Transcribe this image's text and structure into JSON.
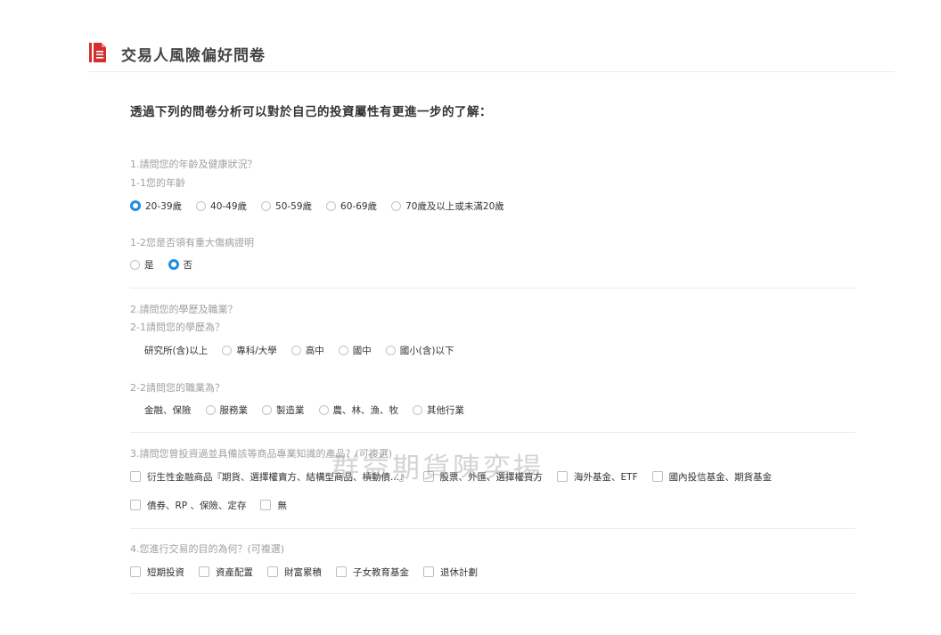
{
  "header": {
    "title": "交易人風險偏好問卷",
    "icon": "document-icon",
    "icon_color": "#d32f2f"
  },
  "intro": "透過下列的問卷分析可以對於自己的投資屬性有更進一步的了解：",
  "q1": {
    "title": "1.請問您的年齡及健康狀況？",
    "sub1": {
      "title": "1-1您的年齡",
      "options": [
        "20-39歲",
        "40-49歲",
        "50-59歲",
        "60-69歲",
        "70歲及以上或未滿20歲"
      ],
      "selected": 0
    },
    "sub2": {
      "title": "1-2您是否領有重大傷病證明",
      "options": [
        "是",
        "否"
      ],
      "selected": 1
    }
  },
  "q2": {
    "title": "2.請問您的學歷及職業？",
    "sub1": {
      "title": "2-1請問您的學歷為？",
      "options": [
        "研究所(含)以上",
        "專科/大學",
        "高中",
        "國中",
        "國小(含)以下"
      ]
    },
    "sub2": {
      "title": "2-2請問您的職業為？",
      "options": [
        "金融、保險",
        "服務業",
        "製造業",
        "農、林、漁、牧",
        "其他行業"
      ]
    }
  },
  "q3": {
    "title": "3.請問您曾投資過並具備該等商品專業知識的產品？(可複選)",
    "row1": [
      "衍生性金融商品『期貨、選擇權賣方、結構型商品、槓動債...』",
      "股票、外匯、選擇權買方",
      "海外基金、ETF",
      "國內投信基金、期貨基金"
    ],
    "row2": [
      "債券、RP 、保險、定存",
      "無"
    ]
  },
  "q4": {
    "title": "4.您進行交易的目的為何？(可複選)",
    "options": [
      "短期投資",
      "資產配置",
      "財富累積",
      "子女教育基金",
      "退休計劃"
    ]
  },
  "watermark": "群益期貨陳奕揚",
  "colors": {
    "accent": "#1e8ee0",
    "question_text": "#a0a0a0",
    "divider": "#ececec"
  }
}
